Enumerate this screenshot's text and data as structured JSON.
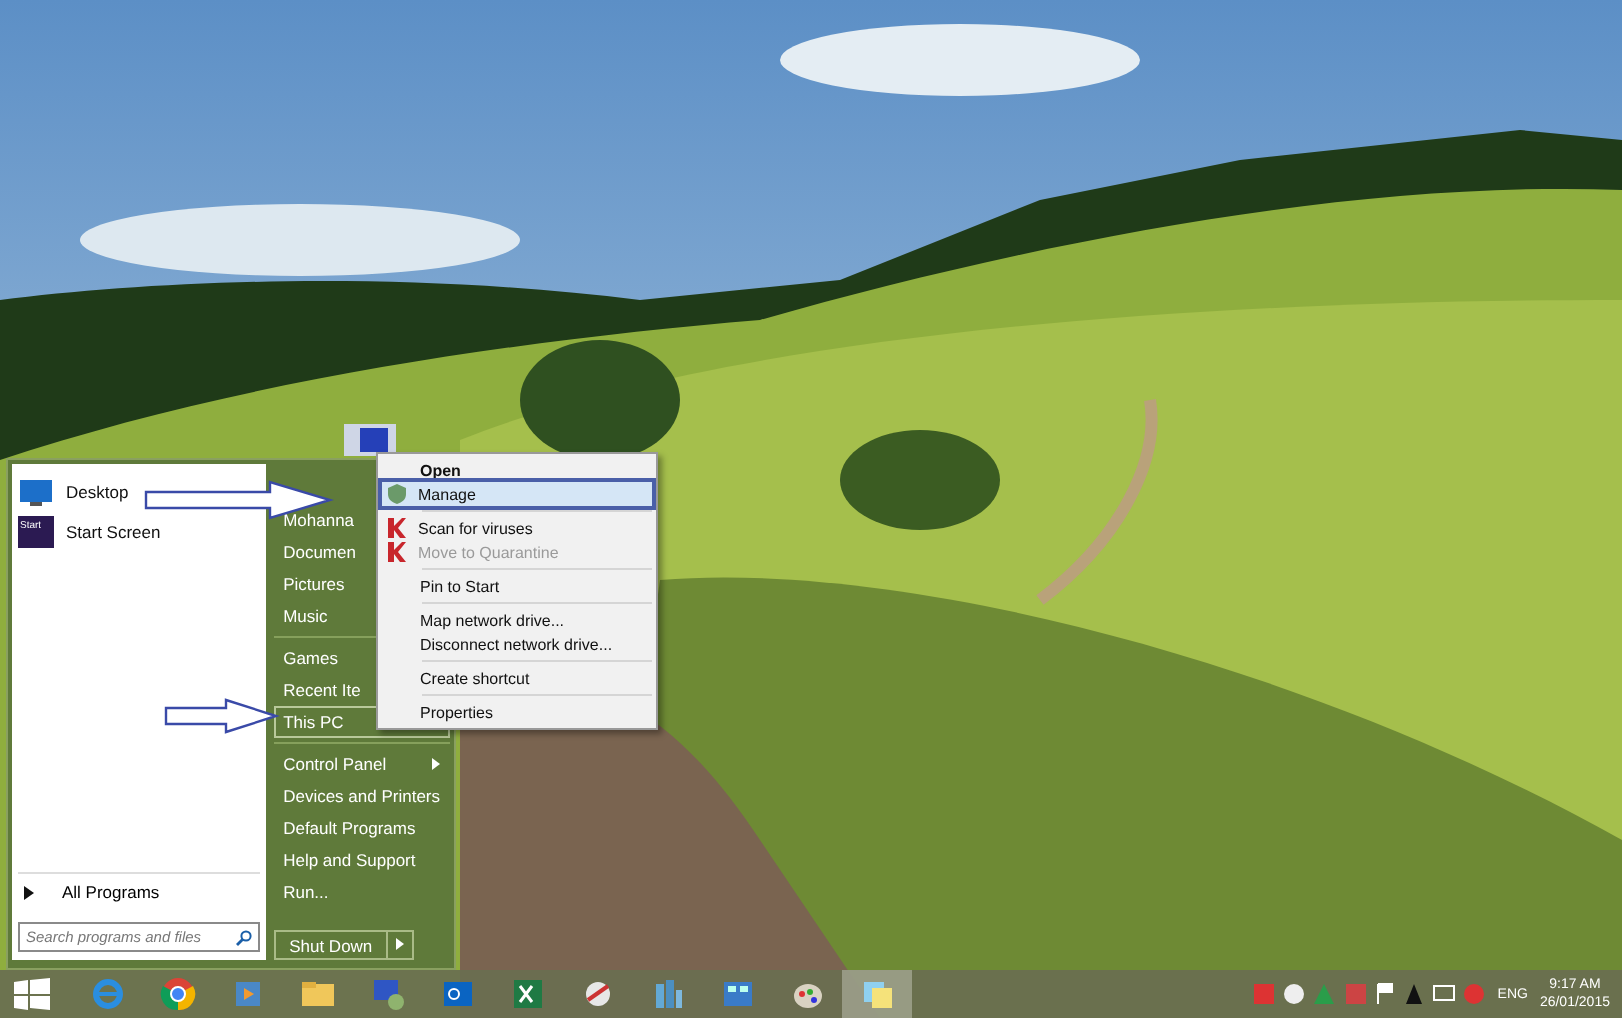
{
  "start_menu": {
    "pinned": [
      {
        "label": "Desktop",
        "kind": "desktop"
      },
      {
        "label": "Start Screen",
        "kind": "startscreen",
        "badge": "Start"
      }
    ],
    "all_programs": "All Programs",
    "search": {
      "placeholder": "Search programs and files"
    },
    "places": [
      [
        {
          "label": "Mohanna",
          "selected": false,
          "submenu": false
        },
        {
          "label": "Documen",
          "selected": false,
          "submenu": false
        },
        {
          "label": "Pictures",
          "selected": false,
          "submenu": false
        },
        {
          "label": "Music",
          "selected": false,
          "submenu": false
        }
      ],
      [
        {
          "label": "Games",
          "selected": false,
          "submenu": false
        },
        {
          "label": "Recent Ite",
          "selected": false,
          "submenu": false
        },
        {
          "label": "This PC",
          "selected": true,
          "submenu": false
        }
      ],
      [
        {
          "label": "Control Panel",
          "selected": false,
          "submenu": true
        },
        {
          "label": "Devices and Printers",
          "selected": false,
          "submenu": false
        },
        {
          "label": "Default Programs",
          "selected": false,
          "submenu": false
        },
        {
          "label": "Help and Support",
          "selected": false,
          "submenu": false
        },
        {
          "label": "Run...",
          "selected": false,
          "submenu": false
        }
      ]
    ],
    "shutdown": "Shut Down"
  },
  "context_menu": {
    "groups": [
      [
        {
          "label": "Open",
          "bold": true,
          "disabled": false,
          "selected": false,
          "kind": "plain"
        },
        {
          "label": "Manage",
          "bold": false,
          "disabled": false,
          "selected": true,
          "kind": "shield"
        }
      ],
      [
        {
          "label": "Scan for viruses",
          "bold": false,
          "disabled": false,
          "selected": false,
          "kind": "antivirus"
        },
        {
          "label": "Move to Quarantine",
          "bold": false,
          "disabled": true,
          "selected": false,
          "kind": "antivirus"
        }
      ],
      [
        {
          "label": "Pin to Start",
          "bold": false,
          "disabled": false,
          "selected": false,
          "kind": "plain"
        }
      ],
      [
        {
          "label": "Map network drive...",
          "bold": false,
          "disabled": false,
          "selected": false,
          "kind": "plain"
        },
        {
          "label": "Disconnect network drive...",
          "bold": false,
          "disabled": false,
          "selected": false,
          "kind": "plain"
        }
      ],
      [
        {
          "label": "Create shortcut",
          "bold": false,
          "disabled": false,
          "selected": false,
          "kind": "plain"
        }
      ],
      [
        {
          "label": "Properties",
          "bold": false,
          "disabled": false,
          "selected": false,
          "kind": "plain"
        }
      ]
    ]
  },
  "taskbar": {
    "apps": [
      {
        "kind": "ie",
        "selected": false
      },
      {
        "kind": "chrome",
        "selected": false
      },
      {
        "kind": "player",
        "selected": false
      },
      {
        "kind": "folder",
        "selected": false
      },
      {
        "kind": "monitor",
        "selected": false
      },
      {
        "kind": "outlook",
        "selected": false
      },
      {
        "kind": "excel",
        "selected": false
      },
      {
        "kind": "tool",
        "selected": false
      },
      {
        "kind": "city",
        "selected": false
      },
      {
        "kind": "panel",
        "selected": false
      },
      {
        "kind": "paint",
        "selected": false
      },
      {
        "kind": "notes",
        "selected": true
      }
    ],
    "language": "ENG",
    "time": "9:17 AM",
    "date": "26/01/2015"
  }
}
